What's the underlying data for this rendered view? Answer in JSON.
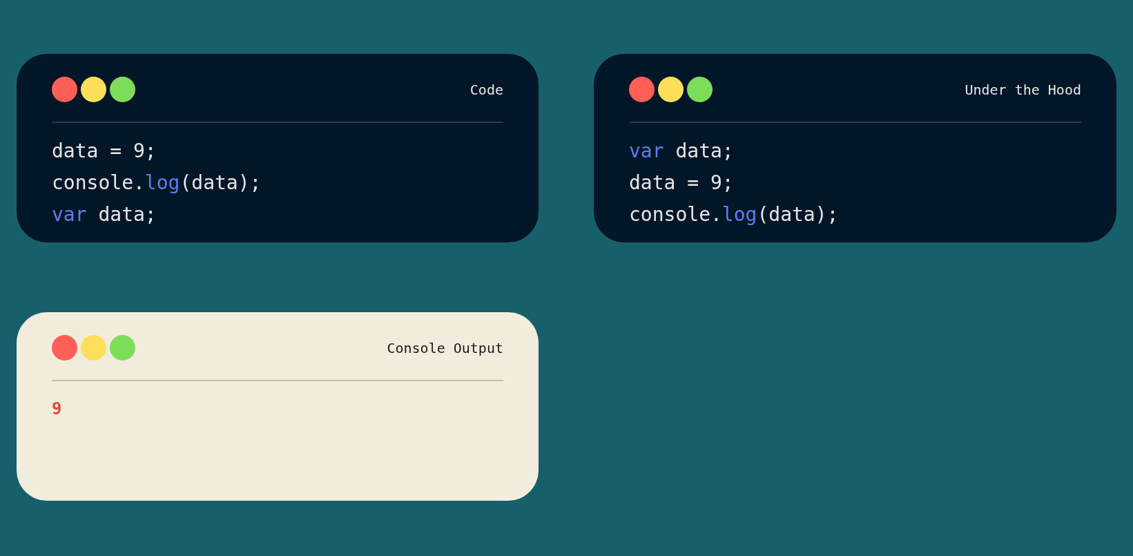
{
  "panels": [
    {
      "title": "Code",
      "kind": "dark",
      "lines": [
        [
          {
            "kind": "plain",
            "text": "data = 9;"
          }
        ],
        [
          {
            "kind": "plain",
            "text": "console."
          },
          {
            "kind": "keyword",
            "text": "log"
          },
          {
            "kind": "plain",
            "text": "(data);"
          }
        ],
        [
          {
            "kind": "keyword",
            "text": "var"
          },
          {
            "kind": "plain",
            "text": " data;"
          }
        ]
      ]
    },
    {
      "title": "Under the Hood",
      "kind": "dark",
      "lines": [
        [
          {
            "kind": "keyword",
            "text": "var"
          },
          {
            "kind": "plain",
            "text": " data;"
          }
        ],
        [
          {
            "kind": "plain",
            "text": "data = 9;"
          }
        ],
        [
          {
            "kind": "plain",
            "text": "console."
          },
          {
            "kind": "keyword",
            "text": "log"
          },
          {
            "kind": "plain",
            "text": "(data);"
          }
        ]
      ]
    },
    {
      "title": "Console Output",
      "kind": "light",
      "output": "9"
    }
  ]
}
